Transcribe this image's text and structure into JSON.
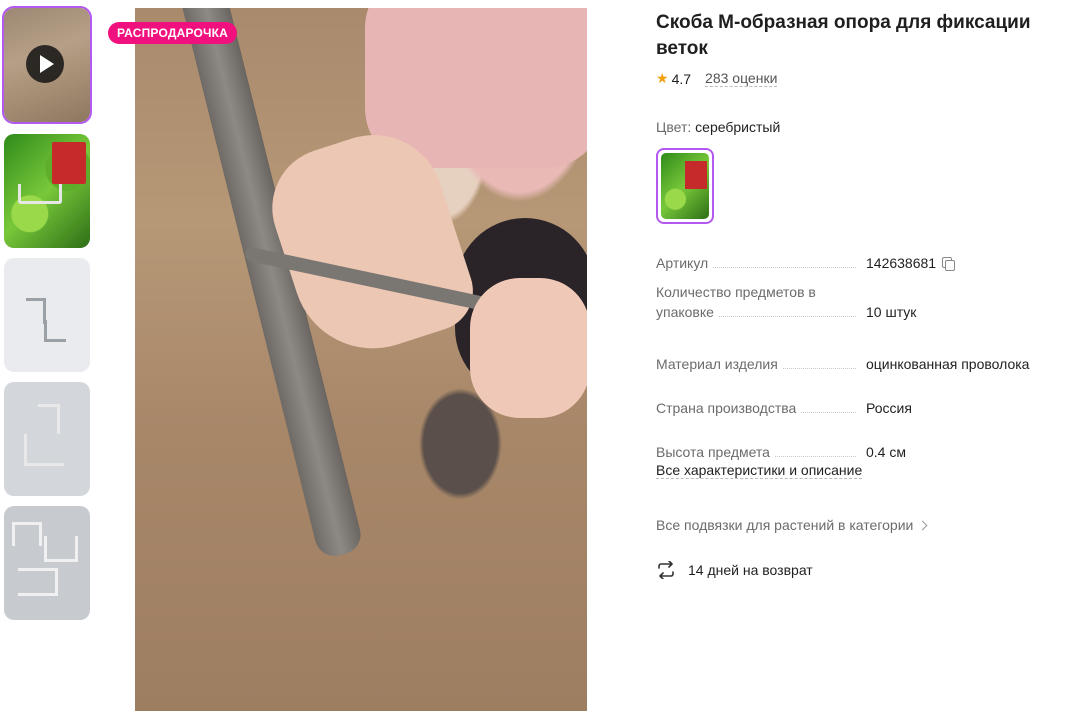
{
  "badge": "РАСПРОДАРОЧКА",
  "product": {
    "title": "Скоба М-образная опора для фиксации веток",
    "rating": "4.7",
    "reviews": "283 оценки"
  },
  "color": {
    "label": "Цвет:",
    "value": "серебристый"
  },
  "specs": [
    {
      "key": "Артикул",
      "value": "142638681"
    },
    {
      "key": "Количество предметов в упаковке",
      "value": "10 штук"
    },
    {
      "key": "Материал изделия",
      "value": "оцинкованная проволока"
    },
    {
      "key": "Страна производства",
      "value": "Россия"
    },
    {
      "key": "Высота предмета",
      "value": "0.4 см"
    }
  ],
  "links": {
    "all_specs": "Все характеристики и описание",
    "category": "Все подвязки для растений в категории"
  },
  "returns": "14 дней на возврат",
  "icons": {
    "play": "play-icon",
    "star": "star-icon",
    "copy": "copy-icon",
    "chevron": "chevron-right-icon",
    "return": "return-arrows-icon"
  },
  "colors": {
    "accent": "#b358f0",
    "badge": "#f1117e",
    "star": "#f59e0b"
  }
}
